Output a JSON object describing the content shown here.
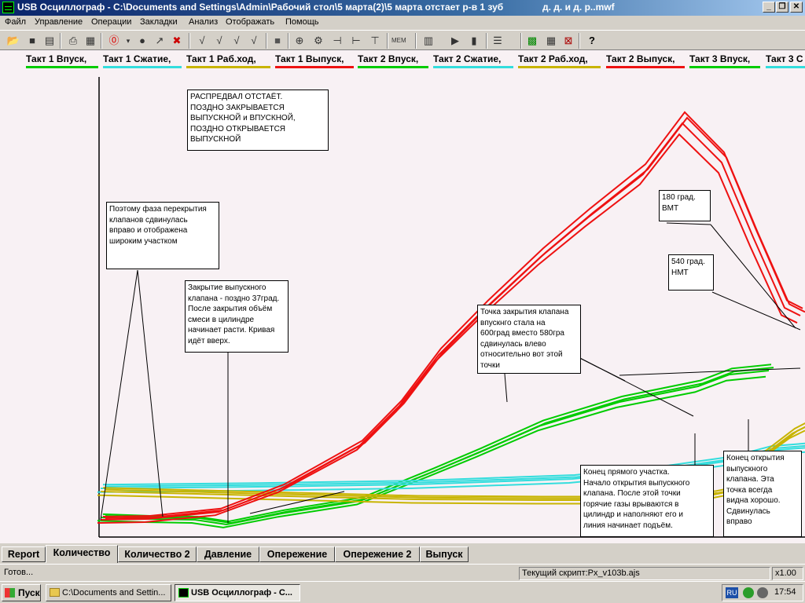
{
  "window": {
    "title": "USB Осциллограф - C:\\Documents and Settings\\Admin\\Рабочий стол\\5 марта(2)\\5 марта отстает р-в 1 зуб",
    "title_extra": "д. д. и  д. р..mwf",
    "btn_min": "_",
    "btn_max": "❐",
    "btn_close": "✕"
  },
  "menu": [
    "Файл",
    "Управление",
    "Операции",
    "Закладки",
    "Анализ",
    "Отображать",
    "Помощь"
  ],
  "toolbar_icons": [
    "open-icon",
    "save-icon",
    "save-as-icon",
    "print-icon",
    "export-icon",
    "stop-icon",
    "dropdown-icon",
    "record-icon",
    "run-icon",
    "tools-icon",
    "check-icon",
    "check2-icon",
    "check3-icon",
    "check4-icon",
    "square-icon",
    "zoom-icon",
    "gears-icon",
    "cursor-icon",
    "cursor2-icon",
    "cursor3-icon",
    "mem-icon",
    "graph-icon",
    "play-icon",
    "play2-icon",
    "list-icon",
    "fit-icon",
    "grid-icon",
    "cross-icon",
    "help-icon"
  ],
  "legend": [
    {
      "label": "Такт 1 Впуск,",
      "color": "#00cc00"
    },
    {
      "label": "Такт 1 Сжатие,",
      "color": "#33dddd"
    },
    {
      "label": "Такт 1 Раб.ход,",
      "color": "#c8b400"
    },
    {
      "label": "Такт 1 Выпуск,",
      "color": "#ee1111"
    },
    {
      "label": "Такт 2 Впуск,",
      "color": "#00cc00"
    },
    {
      "label": "Такт 2 Сжатие,",
      "color": "#33dddd"
    },
    {
      "label": "Такт 2 Раб.ход,",
      "color": "#c8b400"
    },
    {
      "label": "Такт 2 Выпуск,",
      "color": "#ee1111"
    },
    {
      "label": "Такт 3 Впуск,",
      "color": "#00cc00"
    },
    {
      "label": "Такт 3 С",
      "color": "#33dddd"
    }
  ],
  "notes": {
    "n1": "      РАСПРЕДВАЛ  ОТСТАЁТ.\nПОЗДНО ЗАКРЫВАЕТСЯ\nВЫПУСКНОЙ и ВПУСКНОЙ,\nПОЗДНО ОТКРЫВАЕТСЯ\nВЫПУСКНОЙ",
    "n2": "Поэтому фаза перекрытия\nклапанов сдвинулась\nвправо и отображена\nшироким участком",
    "n3": "Закрытие выпускного\nклапана - поздно 37град.\nПосле закрытия объём\nсмеси в цилиндре\nначинает расти. Кривая\nидёт вверх.",
    "n4": "Точка закрытия клапана\nвпускнго стала на\n600град  вместо 580гра\nсдвинулась влево\nотносительно вот этой\n                    точки",
    "n5": "180 град.\n   ВМТ",
    "n6": "540 град.\n   НМТ",
    "n7": "Конец прямого участка.\nНачало открытия выпускного\nклапана. После этой точки\nгорячие газы врываются в\nцилиндр и наполняют его и\nлиния начинает подъём.",
    "n8": "Конец открытия\nвыпускного\nклапана. Эта\nточка всегда\nвидна хорошо.\nСдвинулась\nвправо"
  },
  "tabs": [
    "Report",
    "Количество",
    "Количество 2",
    "Давление",
    "Опережение",
    "Опережение 2",
    "Выпуск"
  ],
  "active_tab": "Количество",
  "status": {
    "left": "Готов...",
    "script": "Текущий скрипт:Px_v103b.ajs",
    "zoom": "x1.00"
  },
  "taskbar": {
    "start": "Пуск",
    "task1": "C:\\Documents and Settin...",
    "task2": "USB Осциллограф - C...",
    "lang": "RU",
    "time": "17:54"
  },
  "chart_data": {
    "type": "line",
    "title": "",
    "xlabel": "",
    "ylabel": "",
    "x_units": "crank angle (deg), relative",
    "series": [
      {
        "name": "Такт 1 Впуск",
        "color": "#00cc00",
        "points": [
          [
            0,
            3
          ],
          [
            60,
            1
          ],
          [
            120,
            0
          ],
          [
            160,
            -6
          ],
          [
            230,
            8
          ],
          [
            330,
            24
          ],
          [
            420,
            60
          ],
          [
            480,
            85
          ],
          [
            560,
            120
          ],
          [
            660,
            150
          ],
          [
            760,
            170
          ],
          [
            800,
            185
          ],
          [
            850,
            190
          ]
        ]
      },
      {
        "name": "Такт 1 Сжатие",
        "color": "#33dddd",
        "points": [
          [
            0,
            40
          ],
          [
            200,
            42
          ],
          [
            400,
            45
          ],
          [
            600,
            52
          ],
          [
            720,
            64
          ],
          [
            800,
            75
          ],
          [
            850,
            88
          ],
          [
            900,
            92
          ]
        ]
      },
      {
        "name": "Такт 1 Раб.ход",
        "color": "#c8b400",
        "points": [
          [
            0,
            36
          ],
          [
            200,
            31
          ],
          [
            400,
            26
          ],
          [
            560,
            25
          ],
          [
            700,
            25
          ],
          [
            780,
            32
          ],
          [
            820,
            40
          ],
          [
            840,
            80
          ],
          [
            880,
            110
          ],
          [
            900,
            120
          ]
        ]
      },
      {
        "name": "Такт 1 Выпуск",
        "color": "#ee1111",
        "points": [
          [
            0,
            0
          ],
          [
            60,
            1
          ],
          [
            150,
            10
          ],
          [
            230,
            40
          ],
          [
            330,
            95
          ],
          [
            380,
            145
          ],
          [
            430,
            210
          ],
          [
            490,
            270
          ],
          [
            560,
            335
          ],
          [
            620,
            385
          ],
          [
            690,
            440
          ],
          [
            740,
            505
          ],
          [
            790,
            455
          ],
          [
            830,
            360
          ],
          [
            870,
            270
          ],
          [
            890,
            260
          ]
        ]
      }
    ],
    "grid": false
  }
}
